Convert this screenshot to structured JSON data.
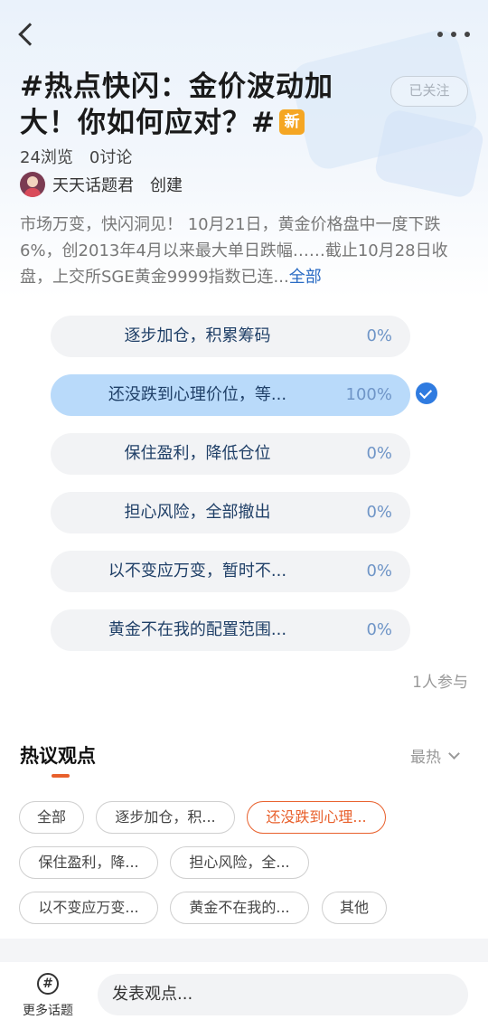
{
  "header": {
    "title": "#热点快闪：金价波动加大！你如何应对？#",
    "new_badge": "新",
    "follow_label": "已关注"
  },
  "stats": {
    "views": "24浏览",
    "discussions": "0讨论"
  },
  "creator": {
    "name": "天天话题君",
    "action": "创建"
  },
  "description": {
    "text": "市场万变，快闪洞见！ 10月21日，黄金价格盘中一度下跌6%，创2013年4月以来最大单日跌幅……截止10月28日收盘，上交所SGE黄金9999指数已连...",
    "more": "全部"
  },
  "poll": {
    "options": [
      {
        "label": "逐步加仓，积累筹码",
        "percent": "0%",
        "selected": false
      },
      {
        "label": "还没跌到心理价位，等...",
        "percent": "100%",
        "selected": true
      },
      {
        "label": "保住盈利，降低仓位",
        "percent": "0%",
        "selected": false
      },
      {
        "label": "担心风险，全部撤出",
        "percent": "0%",
        "selected": false
      },
      {
        "label": "以不变应万变，暂时不...",
        "percent": "0%",
        "selected": false
      },
      {
        "label": "黄金不在我的配置范围...",
        "percent": "0%",
        "selected": false
      }
    ],
    "participants": "1人参与"
  },
  "hot": {
    "title": "热议观点",
    "sort_label": "最热",
    "chips": [
      {
        "label": "全部",
        "active": false
      },
      {
        "label": "逐步加仓，积...",
        "active": false
      },
      {
        "label": "还没跌到心理...",
        "active": true
      },
      {
        "label": "保住盈利，降...",
        "active": false
      },
      {
        "label": "担心风险，全...",
        "active": false
      },
      {
        "label": "以不变应万变...",
        "active": false
      },
      {
        "label": "黄金不在我的...",
        "active": false
      },
      {
        "label": "其他",
        "active": false
      }
    ]
  },
  "bottom_bar": {
    "topics_icon": "#",
    "topics_label": "更多话题",
    "input_placeholder": "发表观点..."
  },
  "colors": {
    "accent_orange": "#e8602c",
    "selected_option": "#b9dafa",
    "check_blue": "#2f7be0",
    "new_badge": "#f5a623"
  }
}
